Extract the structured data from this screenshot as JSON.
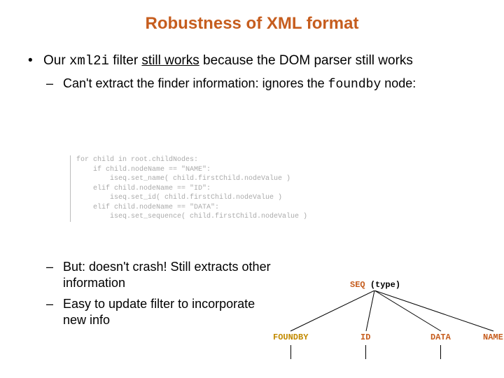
{
  "title": "Robustness of XML format",
  "b1": {
    "pre": "Our ",
    "code": "xml2i",
    "mid": " filter ",
    "u": "still works",
    "post": " because the DOM parser still works"
  },
  "b1a": {
    "pre": "Can't extract the finder information: ignores the ",
    "code": "foundby",
    "post": " node:"
  },
  "code": "for child in root.childNodes:\n    if child.nodeName == \"NAME\":\n        iseq.set_name( child.firstChild.nodeValue )\n    elif child.nodeName == \"ID\":\n        iseq.set_id( child.firstChild.nodeValue )\n    elif child.nodeName == \"DATA\":\n        iseq.set_sequence( child.firstChild.nodeValue )",
  "b2": "But: doesn't crash! Still extracts other information",
  "b3": "Easy to update filter to incorporate new info",
  "tree": {
    "root_lbl": "SEQ",
    "root_type": "(type)",
    "n1": "FOUNDBY",
    "n2": "ID",
    "n3": "DATA",
    "n4": "NAME"
  }
}
